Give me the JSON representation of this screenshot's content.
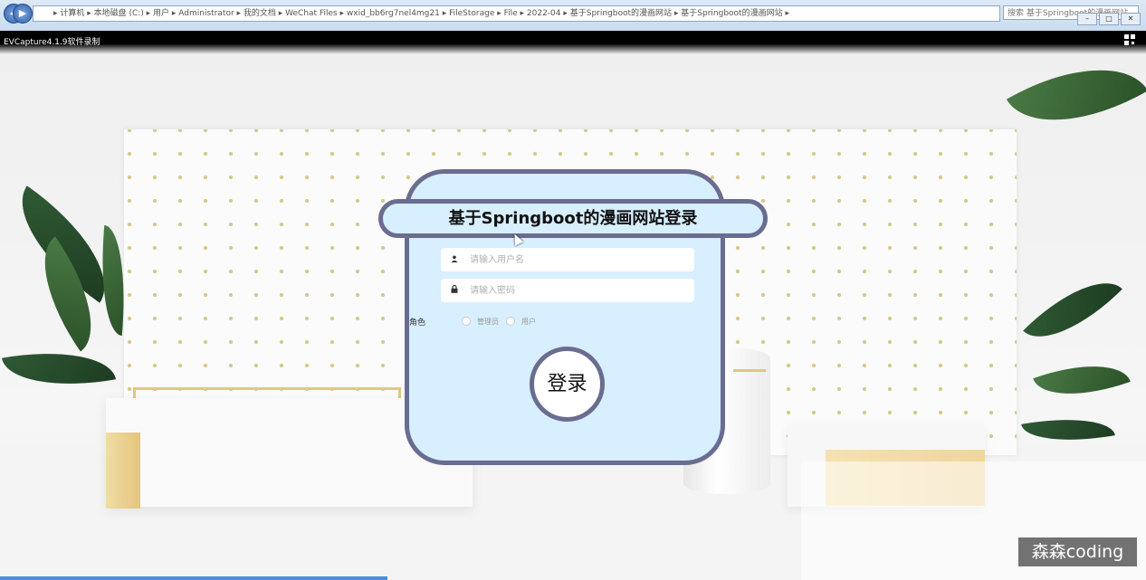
{
  "recorder_caption": "EVCapture4.1.9软件录制",
  "explorer": {
    "address": "▸ 计算机 ▸ 本地磁盘 (C:) ▸ 用户 ▸ Administrator ▸ 我的文档 ▸ WeChat Files ▸ wxid_bb6rg7nel4mg21 ▸ FileStorage ▸ File ▸ 2022-04 ▸ 基于Springboot的漫画网站 ▸ 基于Springboot的漫画网站 ▸",
    "search": "搜索 基于Springboot的漫画网站"
  },
  "login": {
    "title": "基于Springboot的漫画网站登录",
    "username_placeholder": "请输入用户名",
    "password_placeholder": "请输入密码",
    "role_label": "角色",
    "role_options": [
      "管理员",
      "用户"
    ],
    "submit_label": "登录"
  },
  "watermark": "森森coding",
  "icons": {
    "username": "user-icon",
    "password": "lock-icon"
  }
}
